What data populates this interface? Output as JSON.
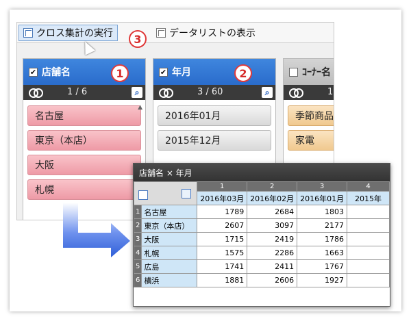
{
  "toolbar": {
    "cross_button_label": "クロス集計の実行",
    "datalist_button_label": "データリストの表示"
  },
  "badges": [
    "1",
    "2",
    "3"
  ],
  "panels": {
    "store": {
      "title": "店舗名",
      "count": "1 / 6",
      "items": [
        "名古屋",
        "東京（本店）",
        "大阪",
        "札幌"
      ]
    },
    "yearmonth": {
      "title": "年月",
      "count": "3 / 60",
      "items": [
        "2016年01月",
        "2015年12月"
      ]
    },
    "corner": {
      "title": "ｺｰﾅｰ名",
      "count": "1",
      "items": [
        "季節商品",
        "家電"
      ]
    }
  },
  "result": {
    "title": "店舗名 × 年月",
    "column_numbers": [
      "1",
      "2",
      "3",
      "4"
    ],
    "columns": [
      "2016年03月",
      "2016年02月",
      "2016年01月",
      "2015年"
    ],
    "rows": [
      {
        "num": "1",
        "label": "名古屋",
        "values": [
          "1789",
          "2684",
          "1803",
          ""
        ]
      },
      {
        "num": "2",
        "label": "東京（本店）",
        "values": [
          "2607",
          "3097",
          "2177",
          ""
        ]
      },
      {
        "num": "3",
        "label": "大阪",
        "values": [
          "1715",
          "2419",
          "1786",
          ""
        ]
      },
      {
        "num": "4",
        "label": "札幌",
        "values": [
          "1575",
          "2286",
          "1663",
          ""
        ]
      },
      {
        "num": "5",
        "label": "広島",
        "values": [
          "1741",
          "2411",
          "1767",
          ""
        ]
      },
      {
        "num": "6",
        "label": "横浜",
        "values": [
          "1881",
          "2606",
          "1927",
          ""
        ]
      }
    ]
  },
  "colors": {
    "panel_header_blue": "#2f78d6",
    "item_pink": "#f2a9b2",
    "header_cell": "#cfe6f7",
    "badge_red": "#e03a3a",
    "arrow_blue": "#3f6fe0"
  }
}
